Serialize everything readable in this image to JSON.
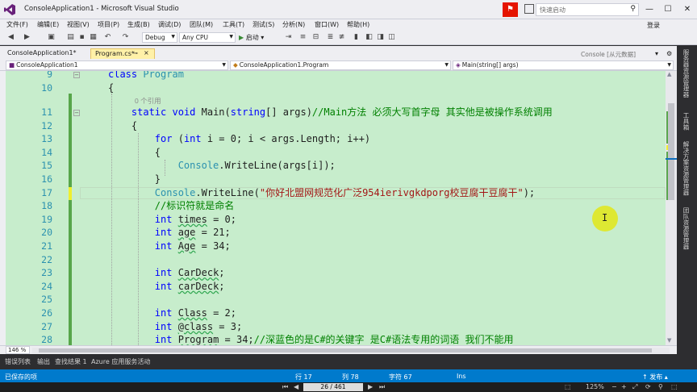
{
  "window": {
    "title": "ConsoleApplication1 - Microsoft Visual Studio",
    "quick_launch_placeholder": "快速启动",
    "signin": "登录"
  },
  "menu": [
    "文件(F)",
    "编辑(E)",
    "视图(V)",
    "项目(P)",
    "生成(B)",
    "调试(D)",
    "团队(M)",
    "工具(T)",
    "测试(S)",
    "分析(N)",
    "窗口(W)",
    "帮助(H)"
  ],
  "toolbar": {
    "config": "Debug",
    "platform": "Any CPU",
    "start_label": "启动"
  },
  "tabs": {
    "project_tab": "ConsoleApplication1*",
    "active_tab": "Program.cs*",
    "right_label": "Console [从元数据]"
  },
  "navbar": {
    "project": "ConsoleApplication1",
    "type": "ConsoleApplication1.Program",
    "member": "Main(string[] args)"
  },
  "editor": {
    "codelens": "0 个引用",
    "lines": [
      {
        "n": "9"
      },
      {
        "n": "10"
      },
      {
        "n": "11"
      },
      {
        "n": "12"
      },
      {
        "n": "13"
      },
      {
        "n": "14"
      },
      {
        "n": "15"
      },
      {
        "n": "16"
      },
      {
        "n": "17"
      },
      {
        "n": "18"
      },
      {
        "n": "19"
      },
      {
        "n": "20"
      },
      {
        "n": "21"
      },
      {
        "n": "22"
      },
      {
        "n": "23"
      },
      {
        "n": "24"
      },
      {
        "n": "25"
      },
      {
        "n": "26"
      },
      {
        "n": "27"
      },
      {
        "n": "28"
      }
    ],
    "comment_main": "//Main方法 必须大写首字母 其实他是被操作系统调用",
    "string_17": "\"你好北盟网规范化广泛954ierivgkdporg校豆腐干豆腐干\"",
    "comment_18": "//标识符就是命名",
    "comment_28": "//深蓝色的是C#的关键字 是C#语法专用的词语 我们不能用"
  },
  "zoom": "146 %",
  "side_tabs": [
    "服务器资源管理器",
    "工具箱",
    "解决方案资源管理器",
    "团队资源管理器"
  ],
  "bottom_tabs": [
    "错误列表",
    "输出",
    "查找结果 1",
    "Azure 应用服务活动"
  ],
  "status": {
    "left": "已保存的项",
    "row": "行 17",
    "col": "列 78",
    "ch": "字符 67",
    "mode": "Ins",
    "publish": "发布"
  },
  "video": {
    "page": "26 / 461",
    "zoom": "125%"
  }
}
